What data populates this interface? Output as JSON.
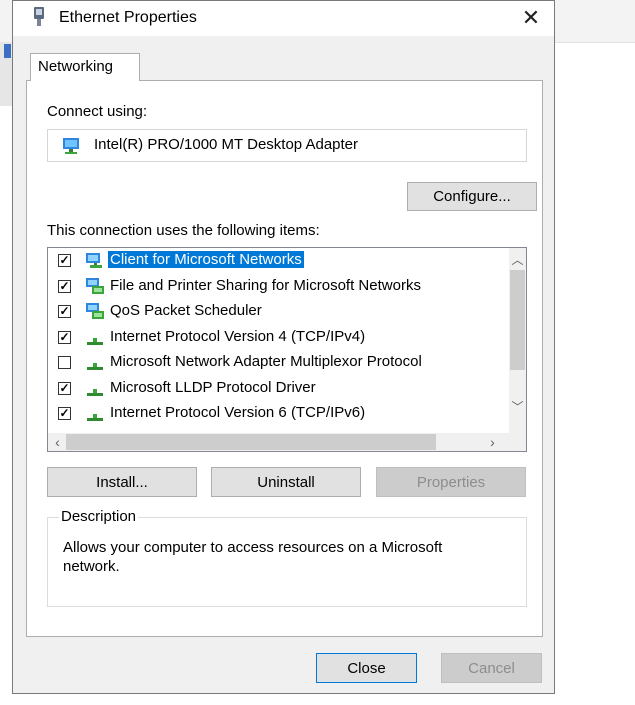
{
  "dialog": {
    "title": "Ethernet Properties",
    "close_glyph": "✕"
  },
  "tabs": [
    {
      "label": "Networking",
      "active": true
    }
  ],
  "networking": {
    "connect_using_label": "Connect using:",
    "adapter_name": "Intel(R) PRO/1000 MT Desktop Adapter",
    "configure_label": "Configure...",
    "items_label": "This connection uses the following items:",
    "items": [
      {
        "label": "Client for Microsoft Networks",
        "checked": true,
        "selected": true,
        "icon": "network-client-icon"
      },
      {
        "label": "File and Printer Sharing for Microsoft Networks",
        "checked": true,
        "selected": false,
        "icon": "network-service-icon"
      },
      {
        "label": "QoS Packet Scheduler",
        "checked": true,
        "selected": false,
        "icon": "network-service-icon"
      },
      {
        "label": "Internet Protocol Version 4 (TCP/IPv4)",
        "checked": true,
        "selected": false,
        "icon": "network-protocol-icon"
      },
      {
        "label": "Microsoft Network Adapter Multiplexor Protocol",
        "checked": false,
        "selected": false,
        "icon": "network-protocol-icon"
      },
      {
        "label": "Microsoft LLDP Protocol Driver",
        "checked": true,
        "selected": false,
        "icon": "network-protocol-icon"
      },
      {
        "label": "Internet Protocol Version 6 (TCP/IPv6)",
        "checked": true,
        "selected": false,
        "icon": "network-protocol-icon"
      }
    ],
    "buttons": {
      "install": "Install...",
      "uninstall": "Uninstall",
      "properties": "Properties"
    },
    "description_label": "Description",
    "description_text": "Allows your computer to access resources on a Microsoft network."
  },
  "footer": {
    "close": "Close",
    "cancel": "Cancel"
  },
  "colors": {
    "selection": "#0078d7",
    "dialog_bg": "#f0f0f0"
  }
}
